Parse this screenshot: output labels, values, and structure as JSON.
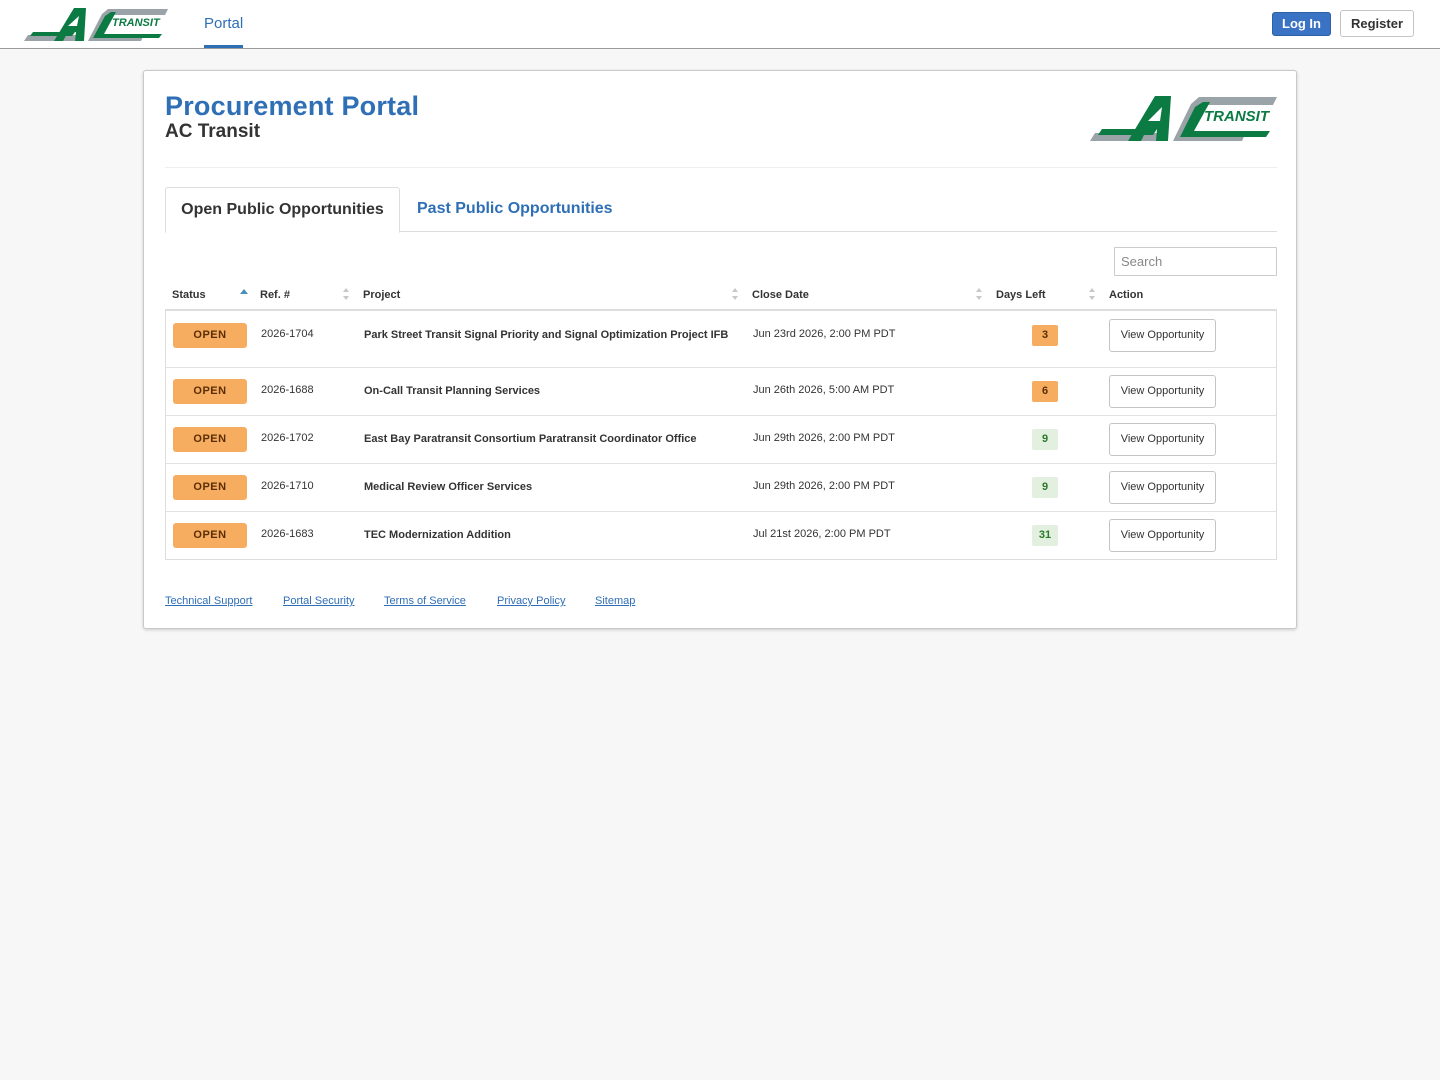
{
  "nav": {
    "portal_link": "Portal",
    "login_label": "Log In",
    "register_label": "Register"
  },
  "header": {
    "title": "Procurement Portal",
    "subtitle": "AC Transit"
  },
  "tabs": [
    {
      "label": "Open Public Opportunities",
      "active": true
    },
    {
      "label": "Past Public Opportunities",
      "active": false
    }
  ],
  "search": {
    "placeholder": "Search",
    "value": ""
  },
  "table": {
    "columns": [
      "Status",
      "Ref. #",
      "Project",
      "Close Date",
      "Days Left",
      "Action"
    ],
    "sorted_column": "Status",
    "sort_direction": "ascending",
    "rows": [
      {
        "status": "OPEN",
        "ref": "2026-1704",
        "project": "Park Street Transit Signal Priority and Signal Optimization Project IFB",
        "close_date": "Jun 23rd 2026, 2:00 PM PDT",
        "days_left": "3",
        "days_level": "warn",
        "action": "View Opportunity"
      },
      {
        "status": "OPEN",
        "ref": "2026-1688",
        "project": "On-Call Transit Planning Services",
        "close_date": "Jun 26th 2026, 5:00 AM PDT",
        "days_left": "6",
        "days_level": "warn",
        "action": "View Opportunity"
      },
      {
        "status": "OPEN",
        "ref": "2026-1702",
        "project": "East Bay Paratransit Consortium Paratransit Coordinator Office",
        "close_date": "Jun 29th 2026, 2:00 PM PDT",
        "days_left": "9",
        "days_level": "ok",
        "action": "View Opportunity"
      },
      {
        "status": "OPEN",
        "ref": "2026-1710",
        "project": "Medical Review Officer Services",
        "close_date": "Jun 29th 2026, 2:00 PM PDT",
        "days_left": "9",
        "days_level": "ok",
        "action": "View Opportunity"
      },
      {
        "status": "OPEN",
        "ref": "2026-1683",
        "project": "TEC Modernization Addition",
        "close_date": "Jul 21st 2026, 2:00 PM PDT",
        "days_left": "31",
        "days_level": "ok",
        "action": "View Opportunity"
      }
    ]
  },
  "footer": {
    "links": [
      "Technical Support",
      "Portal Security",
      "Terms of Service",
      "Privacy Policy",
      "Sitemap"
    ]
  },
  "logo": {
    "text": "TRANSIT",
    "green": "#0c7a43",
    "gray": "#9aa3a7",
    "icon": "ac-transit-logo"
  },
  "colors": {
    "accent": "#2f6fb6",
    "login_button": "#3a72c4",
    "status_open": "#f6ad5f",
    "days_ok_bg": "#e3efdf",
    "days_ok_text": "#2b7a2b"
  }
}
